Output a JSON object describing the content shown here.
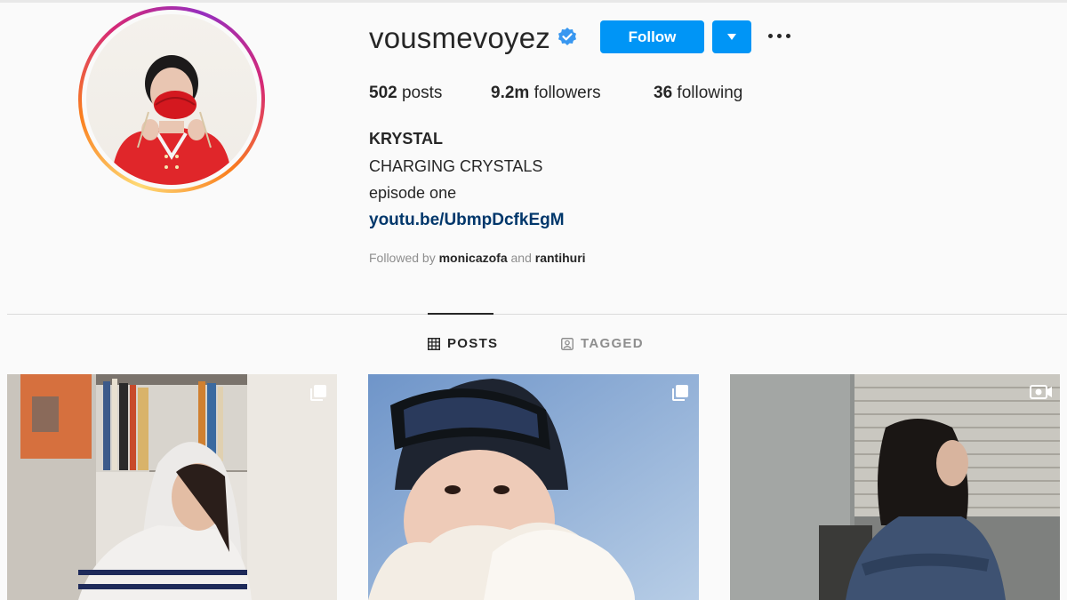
{
  "profile": {
    "username": "vousmevoyez",
    "full_name": "KRYSTAL",
    "bio_line1": "CHARGING CRYSTALS",
    "bio_line2": "episode one",
    "link": "youtu.be/UbmpDcfkEgM"
  },
  "actions": {
    "follow_label": "Follow",
    "accent": "#0095f6"
  },
  "stats": {
    "posts_count": "502",
    "posts_label": "posts",
    "followers_count": "9.2m",
    "followers_label": "followers",
    "following_count": "36",
    "following_label": "following"
  },
  "followed_by": {
    "prefix": "Followed by",
    "user1": "monicazofa",
    "conjunction": "and",
    "user2": "rantihuri"
  },
  "tabs": [
    {
      "label": "POSTS",
      "icon": "grid-icon",
      "active": true
    },
    {
      "label": "TAGGED",
      "icon": "tagged-icon",
      "active": false
    }
  ],
  "posts": [
    {
      "type": "carousel",
      "icon": "carousel-icon"
    },
    {
      "type": "carousel",
      "icon": "carousel-icon"
    },
    {
      "type": "video",
      "icon": "video-icon"
    }
  ],
  "colors": {
    "link": "#00376b",
    "muted": "#8e8e8e",
    "verified": "#3897f0"
  }
}
